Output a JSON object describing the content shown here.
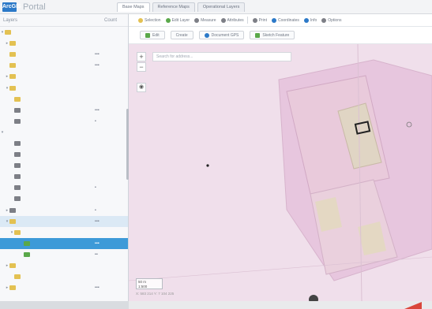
{
  "app": {
    "logo_text": "ArcGIS",
    "title": "Portal"
  },
  "tabs": [
    {
      "label": "Base Maps"
    },
    {
      "label": "Reference Maps"
    },
    {
      "label": "Operational Layers"
    }
  ],
  "sidebar": {
    "header_left": "Layers",
    "header_right": "Count"
  },
  "toolbar1": {
    "items": [
      {
        "label": "Selection",
        "color": "#e3c152"
      },
      {
        "label": "Edit Layer",
        "color": "#5aa84a"
      },
      {
        "label": "Measure",
        "color": "#7d7f86"
      },
      {
        "label": "Attributes",
        "color": "#7d7f86"
      },
      {
        "label": "Print",
        "color": "#7d7f86"
      },
      {
        "label": "Coordinates",
        "color": "#2c79c8"
      },
      {
        "label": "Info",
        "color": "#2c79c8"
      },
      {
        "label": "Options",
        "color": "#7d7f86"
      }
    ]
  },
  "toolbar2": {
    "save_label": "Edit",
    "create_label": "Create",
    "dropdown_label": "Document GPS",
    "snap_label": "Sketch Feature"
  },
  "map": {
    "search_placeholder": "Search for address...",
    "zoom_in": "+",
    "zoom_out": "−",
    "eye_icon_glyph": "◉"
  },
  "status": {
    "scale_line1": "50 m",
    "scale_line2": "1:500",
    "coords": "X: 583 214   Y: 7 104 225"
  },
  "chart_data": null
}
